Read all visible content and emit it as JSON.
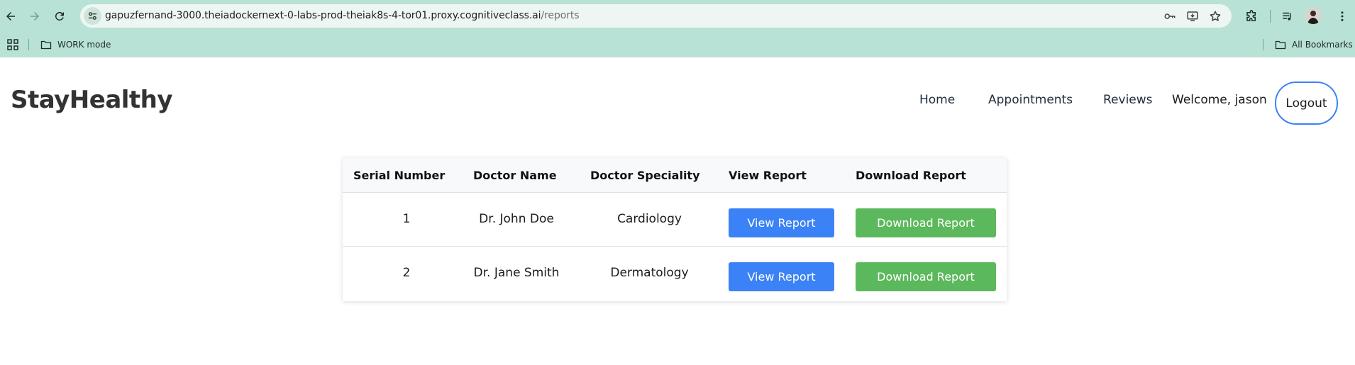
{
  "browser": {
    "url_host": "gapuzfernand-3000.theiadockernext-0-labs-prod-theiak8s-4-tor01.proxy.cognitiveclass.ai",
    "url_path": "/reports",
    "bookmarks": [
      {
        "label": "WORK mode",
        "icon": "folder-icon"
      }
    ],
    "all_bookmarks_label": "All Bookmarks",
    "colors": {
      "chrome": "#b8e2d5",
      "omnibox": "#edf6f2"
    }
  },
  "header": {
    "brand": "StayHealthy",
    "nav": {
      "home": "Home",
      "appointments": "Appointments",
      "reviews": "Reviews"
    },
    "welcome": "Welcome, jason",
    "logout": "Logout"
  },
  "table": {
    "columns": [
      "Serial Number",
      "Doctor Name",
      "Doctor Speciality",
      "View Report",
      "Download Report"
    ],
    "rows": [
      {
        "serial": "1",
        "doctor": "Dr. John Doe",
        "speciality": "Cardiology",
        "view": "View Report",
        "download": "Download Report"
      },
      {
        "serial": "2",
        "doctor": "Dr. Jane Smith",
        "speciality": "Dermatology",
        "view": "View Report",
        "download": "Download Report"
      }
    ]
  },
  "colors": {
    "view_button": "#3b82f6",
    "download_button": "#5cb85c",
    "logout_border": "#3b82f6"
  }
}
